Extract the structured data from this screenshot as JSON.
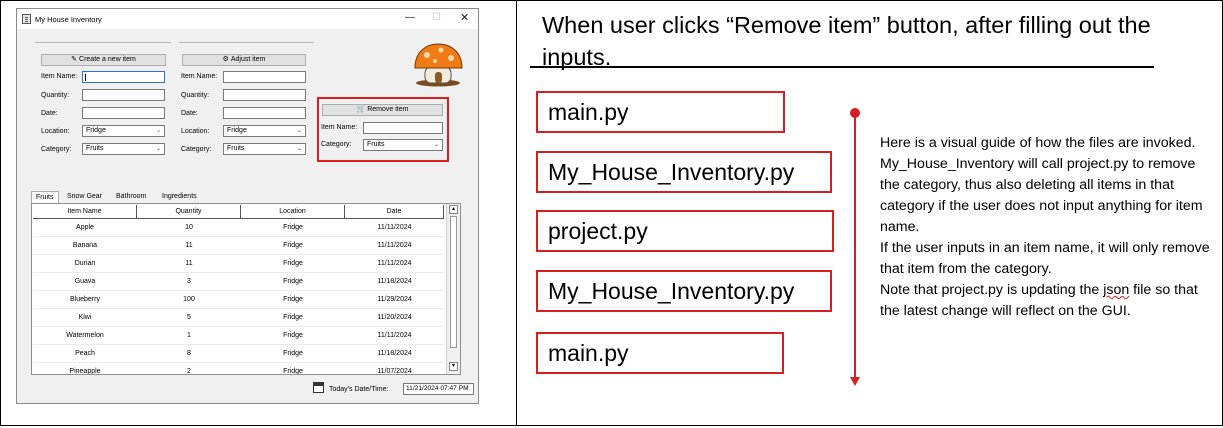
{
  "app": {
    "title": "My House Inventory",
    "controls": {
      "minimize": "—",
      "maximize": "☐",
      "close": "✕"
    },
    "buttons": {
      "create": "Create a new item",
      "adjust": "Adjust item",
      "remove": "Remove item"
    },
    "create_form": {
      "item_name_label": "Item Name:",
      "quantity_label": "Quantity:",
      "date_label": "Date:",
      "location_label": "Location:",
      "location_value": "Fridge",
      "category_label": "Category:",
      "category_value": "Fruits"
    },
    "adjust_form": {
      "item_name_label": "Item Name:",
      "quantity_label": "Quantity:",
      "date_label": "Date:",
      "location_label": "Location:",
      "location_value": "Fridge",
      "category_label": "Category:",
      "category_value": "Fruits"
    },
    "remove_form": {
      "item_name_label": "Item Name:",
      "category_label": "Category:",
      "category_value": "Fruits"
    },
    "tabs": [
      "Fruits",
      "Snow Gear",
      "Bathroom",
      "Ingredients"
    ],
    "active_tab": "Fruits",
    "columns": [
      "Item Name",
      "Quantity",
      "Location",
      "Date"
    ],
    "rows": [
      [
        "Apple",
        "10",
        "Fridge",
        "11/11/2024"
      ],
      [
        "Banana",
        "11",
        "Fridge",
        "11/11/2024"
      ],
      [
        "Durian",
        "11",
        "Fridge",
        "11/11/2024"
      ],
      [
        "Guava",
        "3",
        "Fridge",
        "11/18/2024"
      ],
      [
        "Blueberry",
        "100",
        "Fridge",
        "11/29/2024"
      ],
      [
        "Kiwi",
        "5",
        "Fridge",
        "11/20/2024"
      ],
      [
        "Watermelon",
        "1",
        "Fridge",
        "11/11/2024"
      ],
      [
        "Peach",
        "8",
        "Fridge",
        "11/18/2024"
      ],
      [
        "Pineapple",
        "2",
        "Fridge",
        "11/07/2024"
      ]
    ],
    "footer": {
      "date_label": "Today's Date/Time:",
      "date_value": "11/21/2024 07:47 PM"
    },
    "icons": {
      "create": "pencil-icon",
      "adjust": "gear-icon",
      "remove": "cart-icon",
      "calendar": "calendar-icon",
      "logo": "mushroom-house-logo"
    }
  },
  "diagram": {
    "heading": "When user clicks “Remove item” button, after filling out the inputs.",
    "steps": [
      "main.py",
      "My_House_Inventory.py",
      "project.py",
      "My_House_Inventory.py",
      "main.py"
    ],
    "description": {
      "paragraph1": "Here is a visual guide of how the files are invoked. My_House_Inventory will call project.py to remove the category, thus also deleting all items in that category if the user does not input anything for item name.",
      "paragraph2": "If the user inputs in an item name, it will only remove that item from the category.",
      "paragraph3_before": "Note that project.py is updating the ",
      "paragraph3_word": "json",
      "paragraph3_after": " file so that the latest change will reflect on the GUI."
    },
    "colors": {
      "accent": "#d81e1e"
    }
  }
}
